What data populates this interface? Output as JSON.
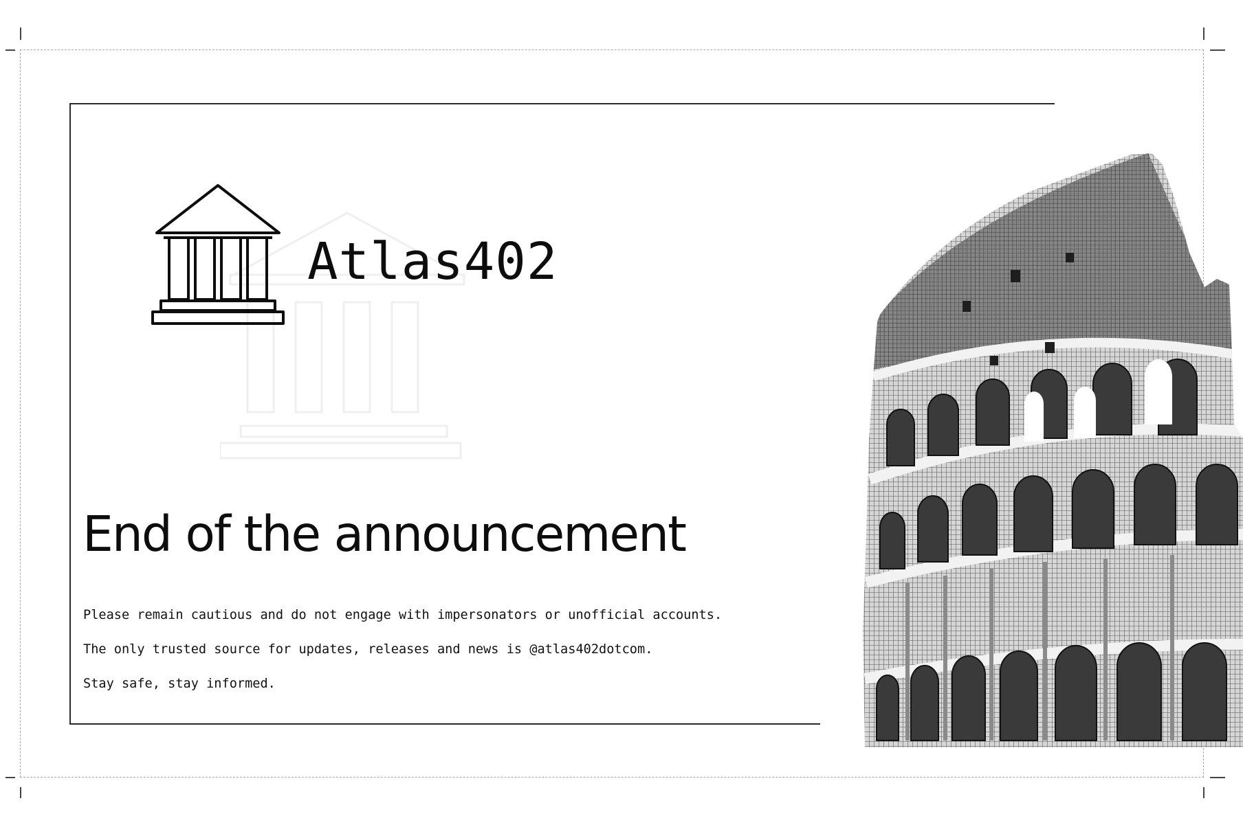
{
  "brand": {
    "name": "Atlas402",
    "logo_icon": "temple-columns-icon"
  },
  "announcement": {
    "heading": "End of the announcement",
    "lines": [
      "Please remain cautious and do not engage with impersonators or unofficial accounts.",
      "The only trusted source for updates, releases and news is @atlas402dotcom.",
      "Stay safe, stay informed."
    ]
  },
  "illustration": {
    "icon": "colosseum-icon"
  },
  "colors": {
    "text": "#0d0d0d",
    "background": "#ffffff",
    "frame": "#a6a6a6"
  }
}
